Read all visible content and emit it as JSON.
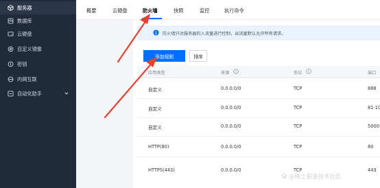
{
  "sidebar": {
    "items": [
      {
        "label": "服务器",
        "icon": "cube-icon"
      },
      {
        "label": "数据库",
        "icon": "database-icon"
      },
      {
        "label": "云硬盘",
        "icon": "disk-icon"
      },
      {
        "label": "自定义镜像",
        "icon": "image-icon"
      },
      {
        "label": "密钥",
        "icon": "key-icon"
      },
      {
        "label": "内网互联",
        "icon": "network-icon"
      },
      {
        "label": "自动化助手",
        "icon": "automation-icon"
      }
    ]
  },
  "tabs": [
    "概要",
    "云硬盘",
    "防火墙",
    "快照",
    "监控",
    "执行命令"
  ],
  "active_tab": "防火墙",
  "notice": {
    "text": "防火墙只对服务器的入流量进行控制，出流量默认允许所有请求。"
  },
  "buttons": {
    "add_rule": "添加规则",
    "sort": "排序"
  },
  "table": {
    "headers": [
      "应用类型",
      "来源",
      "协议",
      "端口"
    ],
    "rows": [
      [
        "自定义",
        "0.0.0.0/0",
        "TCP",
        "888"
      ],
      [
        "自定义",
        "0.0.0.0/0",
        "TCP",
        "81-10"
      ],
      [
        "自定义",
        "0.0.0.0/0",
        "TCP",
        "5000-"
      ],
      [
        "HTTP(80)",
        "0.0.0.0/0",
        "TCP",
        "80"
      ],
      [
        "HTTPS(443)",
        "0.0.0.0/0",
        "TCP",
        "443"
      ]
    ]
  },
  "watermark": "@稀土掘金技术社区",
  "colors": {
    "sidebar_bg": "#1f2a3a",
    "primary": "#006eff",
    "annotation_arrow": "#e8402f"
  }
}
